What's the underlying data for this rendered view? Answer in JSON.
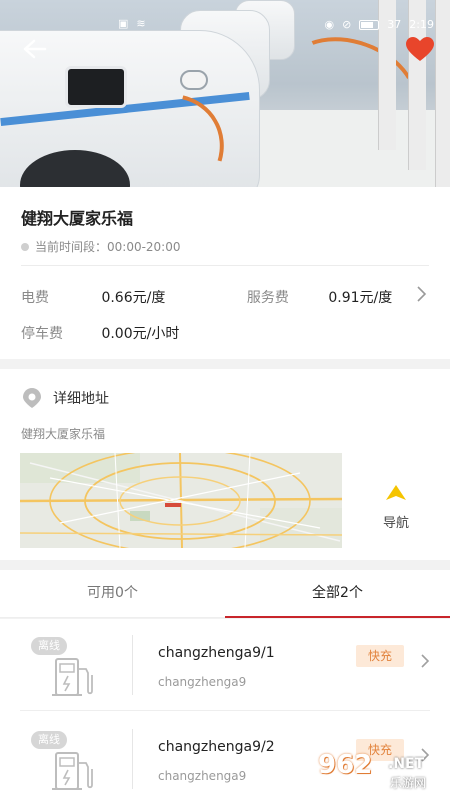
{
  "status_bar": {
    "time": "2:19",
    "battery": "37"
  },
  "header": {
    "back_icon": "arrow-left-icon",
    "favorite_icon": "heart-icon",
    "favorite_color": "#e8452b"
  },
  "station": {
    "name": "健翔大厦家乐福",
    "time_label": "当前时间段：00:00-20:00",
    "electric_label": "电费",
    "electric_value": "0.66元/度",
    "service_label": "服务费",
    "service_value": "0.91元/度",
    "parking_label": "停车费",
    "parking_value": "0.00元/小时"
  },
  "address": {
    "heading": "详细地址",
    "text": "健翔大厦家乐福",
    "nav_label": "导航",
    "nav_icon_color": "#f5c400"
  },
  "tabs": [
    {
      "label": "可用0个"
    },
    {
      "label": "全部2个"
    }
  ],
  "accent_color": "#c8252b",
  "chargers": [
    {
      "status": "离线",
      "name": "changzhenga9/1",
      "sub": "changzhenga9",
      "type": "快充"
    },
    {
      "status": "离线",
      "name": "changzhenga9/2",
      "sub": "changzhenga9",
      "type": "快充"
    }
  ],
  "watermark": {
    "number": "962",
    "net": ".NET",
    "cn": "乐游网"
  }
}
